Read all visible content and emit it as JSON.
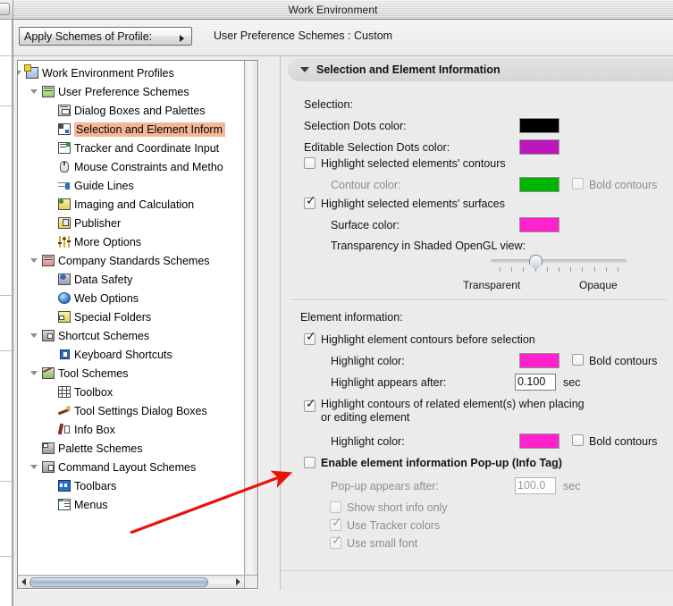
{
  "window": {
    "title": "Work Environment"
  },
  "toolbar": {
    "profile_button_label": "Apply Schemes of Profile:",
    "profile_value": "User Preference Schemes : Custom",
    "dropdown_icon": "triangle-right-icon"
  },
  "tree": {
    "items": [
      {
        "label": "Work Environment Profiles",
        "indent": 0,
        "twisty": "down",
        "icon": "monitor-badge-icon",
        "selected": false
      },
      {
        "label": "User Preference Schemes",
        "indent": 1,
        "twisty": "down",
        "icon": "scheme-green-icon",
        "selected": false
      },
      {
        "label": "Dialog Boxes and Palettes",
        "indent": 2,
        "twisty": "none",
        "icon": "dialog-icon",
        "selected": false
      },
      {
        "label": "Selection and Element Inform",
        "indent": 2,
        "twisty": "none",
        "icon": "selection-icon",
        "selected": true
      },
      {
        "label": "Tracker and Coordinate Input",
        "indent": 2,
        "twisty": "none",
        "icon": "tracker-icon",
        "selected": false
      },
      {
        "label": "Mouse Constraints and Metho",
        "indent": 2,
        "twisty": "none",
        "icon": "mouse-icon",
        "selected": false
      },
      {
        "label": "Guide Lines",
        "indent": 2,
        "twisty": "none",
        "icon": "guideline-icon",
        "selected": false
      },
      {
        "label": "Imaging and Calculation",
        "indent": 2,
        "twisty": "none",
        "icon": "imaging-icon",
        "selected": false
      },
      {
        "label": "Publisher",
        "indent": 2,
        "twisty": "none",
        "icon": "publisher-icon",
        "selected": false
      },
      {
        "label": "More Options",
        "indent": 2,
        "twisty": "none",
        "icon": "sliders-icon",
        "selected": false
      },
      {
        "label": "Company Standards Schemes",
        "indent": 1,
        "twisty": "down",
        "icon": "scheme-red-icon",
        "selected": false
      },
      {
        "label": "Data Safety",
        "indent": 2,
        "twisty": "none",
        "icon": "floppy-clock-icon",
        "selected": false
      },
      {
        "label": "Web Options",
        "indent": 2,
        "twisty": "none",
        "icon": "globe-icon",
        "selected": false
      },
      {
        "label": "Special Folders",
        "indent": 2,
        "twisty": "none",
        "icon": "folder-icon",
        "selected": false
      },
      {
        "label": "Shortcut Schemes",
        "indent": 1,
        "twisty": "down",
        "icon": "shortcut-scheme-icon",
        "selected": false
      },
      {
        "label": "Keyboard Shortcuts",
        "indent": 2,
        "twisty": "none",
        "icon": "arrow-key-icon",
        "selected": false
      },
      {
        "label": "Tool Schemes",
        "indent": 1,
        "twisty": "down",
        "icon": "tools-icon",
        "selected": false
      },
      {
        "label": "Toolbox",
        "indent": 2,
        "twisty": "none",
        "icon": "grid-icon",
        "selected": false
      },
      {
        "label": "Tool Settings Dialog Boxes",
        "indent": 2,
        "twisty": "none",
        "icon": "wrench-icon",
        "selected": false
      },
      {
        "label": "Info Box",
        "indent": 2,
        "twisty": "none",
        "icon": "info-box-icon",
        "selected": false
      },
      {
        "label": "Palette Schemes",
        "indent": 1,
        "twisty": "none",
        "icon": "palette-scheme-icon",
        "selected": false
      },
      {
        "label": "Command Layout Schemes",
        "indent": 1,
        "twisty": "down",
        "icon": "layout-scheme-icon",
        "selected": false
      },
      {
        "label": "Toolbars",
        "indent": 2,
        "twisty": "none",
        "icon": "toolbar-icon",
        "selected": false
      },
      {
        "label": "Menus",
        "indent": 2,
        "twisty": "none",
        "icon": "menus-icon",
        "selected": false
      }
    ],
    "hscroll_icon_left": "scroll-left-arrow-icon",
    "hscroll_icon_right": "scroll-right-arrow-icon"
  },
  "settings": {
    "section_title": "Selection and Element Information",
    "section_twisty": "triangle-down-icon",
    "selection_group_label": "Selection:",
    "selection_dots_label": "Selection Dots color:",
    "selection_dots_color": "#000000",
    "editable_dots_label": "Editable Selection Dots color:",
    "editable_dots_color": "#BC16BC",
    "highlight_contours_label": "Highlight selected elements' contours",
    "highlight_contours_checked": false,
    "contour_color_label": "Contour color:",
    "contour_color": "#00B500",
    "bold_contours_1_label": "Bold contours",
    "bold_contours_1_checked": false,
    "highlight_surfaces_label": "Highlight selected elements' surfaces",
    "highlight_surfaces_checked": true,
    "surface_color_label": "Surface color:",
    "surface_color": "#FF22CC",
    "transparency_label": "Transparency in Shaded OpenGL view:",
    "transparency_min_label": "Transparent",
    "transparency_max_label": "Opaque",
    "transparency_ticks": 11,
    "transparency_value_index": 3,
    "element_info_group_label": "Element information:",
    "highlight_before_selection_label": "Highlight element contours before selection",
    "highlight_before_selection_checked": true,
    "highlight_color_1_label": "Highlight color:",
    "highlight_color_1": "#FF22CC",
    "bold_contours_2_label": "Bold contours",
    "bold_contours_2_checked": false,
    "highlight_appears_after_label": "Highlight appears after:",
    "highlight_appears_after_value": "0.100",
    "highlight_appears_after_unit": "sec",
    "highlight_related_label_line1": "Highlight contours of related element(s) when placing",
    "highlight_related_label_line2": "or editing element",
    "highlight_related_checked": true,
    "highlight_color_2_label": "Highlight color:",
    "highlight_color_2": "#FF22CC",
    "bold_contours_3_label": "Bold contours",
    "bold_contours_3_checked": false,
    "enable_popup_label": "Enable element information Pop-up (Info Tag)",
    "enable_popup_checked": false,
    "popup_appears_after_label": "Pop-up appears after:",
    "popup_appears_after_value": "100.0",
    "popup_appears_after_unit": "sec",
    "show_short_info_label": "Show short info only",
    "show_short_info_checked": false,
    "use_tracker_colors_label": "Use Tracker colors",
    "use_tracker_colors_checked": true,
    "use_small_font_label": "Use small font",
    "use_small_font_checked": true,
    "checkmark_glyph": "✓"
  },
  "annotation": {
    "arrow_color": "#E8140A",
    "name": "red-pointer-arrow"
  }
}
